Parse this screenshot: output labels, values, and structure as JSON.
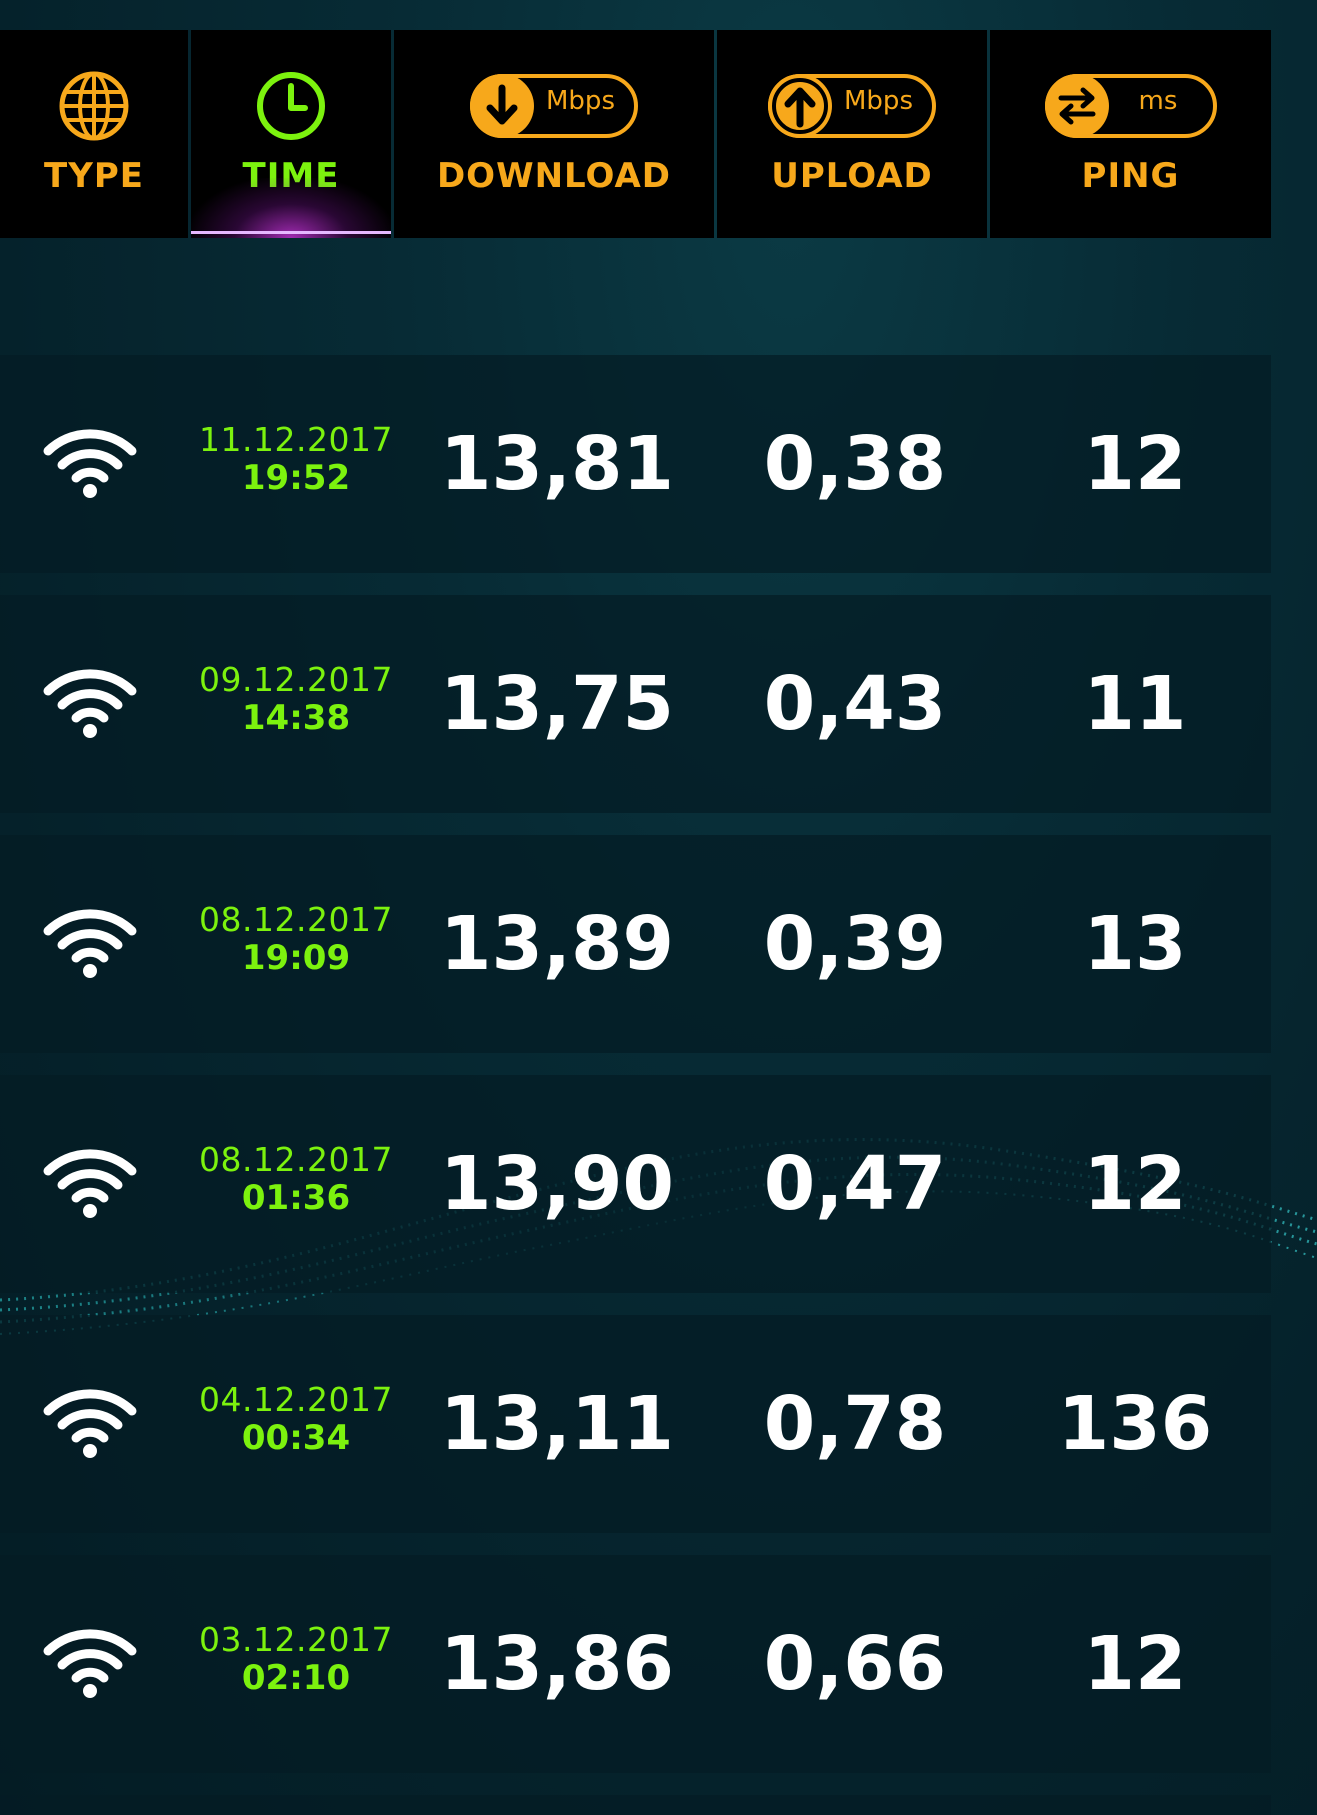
{
  "header": {
    "tabs": [
      {
        "label": "TYPE",
        "icon": "globe-icon"
      },
      {
        "label": "TIME",
        "icon": "clock-icon",
        "active": true
      },
      {
        "label": "DOWNLOAD",
        "icon": "download-icon",
        "unit": "Mbps"
      },
      {
        "label": "UPLOAD",
        "icon": "upload-icon",
        "unit": "Mbps"
      },
      {
        "label": "PING",
        "icon": "ping-icon",
        "unit": "ms"
      }
    ]
  },
  "results": [
    {
      "type": "wifi-icon",
      "date": "11.12.2017",
      "time": "19:52",
      "download": "13,81",
      "upload": "0,38",
      "ping": "12"
    },
    {
      "type": "wifi-icon",
      "date": "09.12.2017",
      "time": "14:38",
      "download": "13,75",
      "upload": "0,43",
      "ping": "11"
    },
    {
      "type": "wifi-icon",
      "date": "08.12.2017",
      "time": "19:09",
      "download": "13,89",
      "upload": "0,39",
      "ping": "13"
    },
    {
      "type": "wifi-icon",
      "date": "08.12.2017",
      "time": "01:36",
      "download": "13,90",
      "upload": "0,47",
      "ping": "12"
    },
    {
      "type": "wifi-icon",
      "date": "04.12.2017",
      "time": "00:34",
      "download": "13,11",
      "upload": "0,78",
      "ping": "136"
    },
    {
      "type": "wifi-icon",
      "date": "03.12.2017",
      "time": "02:10",
      "download": "13,86",
      "upload": "0,66",
      "ping": "12"
    }
  ],
  "colors": {
    "accent_orange": "#f7a81b",
    "accent_green": "#7cf20e",
    "active_glow": "#be32d2",
    "value_text": "#ffffff"
  }
}
